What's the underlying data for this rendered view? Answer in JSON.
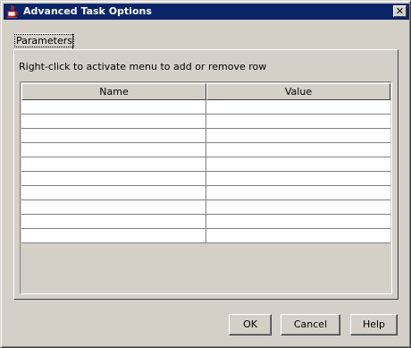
{
  "window": {
    "title": "Advanced Task Options",
    "title_icon": "java-cup-icon",
    "close_glyph": "✕"
  },
  "tabs": [
    {
      "label": "Parameters",
      "active": true
    }
  ],
  "panel": {
    "hint": "Right-click to activate menu to add or remove row"
  },
  "table": {
    "columns": [
      "Name",
      "Value"
    ],
    "rows": [
      [
        "",
        ""
      ],
      [
        "",
        ""
      ],
      [
        "",
        ""
      ],
      [
        "",
        ""
      ],
      [
        "",
        ""
      ],
      [
        "",
        ""
      ],
      [
        "",
        ""
      ],
      [
        "",
        ""
      ],
      [
        "",
        ""
      ],
      [
        "",
        ""
      ]
    ]
  },
  "buttons": {
    "ok": "OK",
    "cancel": "Cancel",
    "help": "Help"
  },
  "colors": {
    "face": "#d4d0c8",
    "titlebar": "#0a246a",
    "cell": "#ffffff"
  }
}
